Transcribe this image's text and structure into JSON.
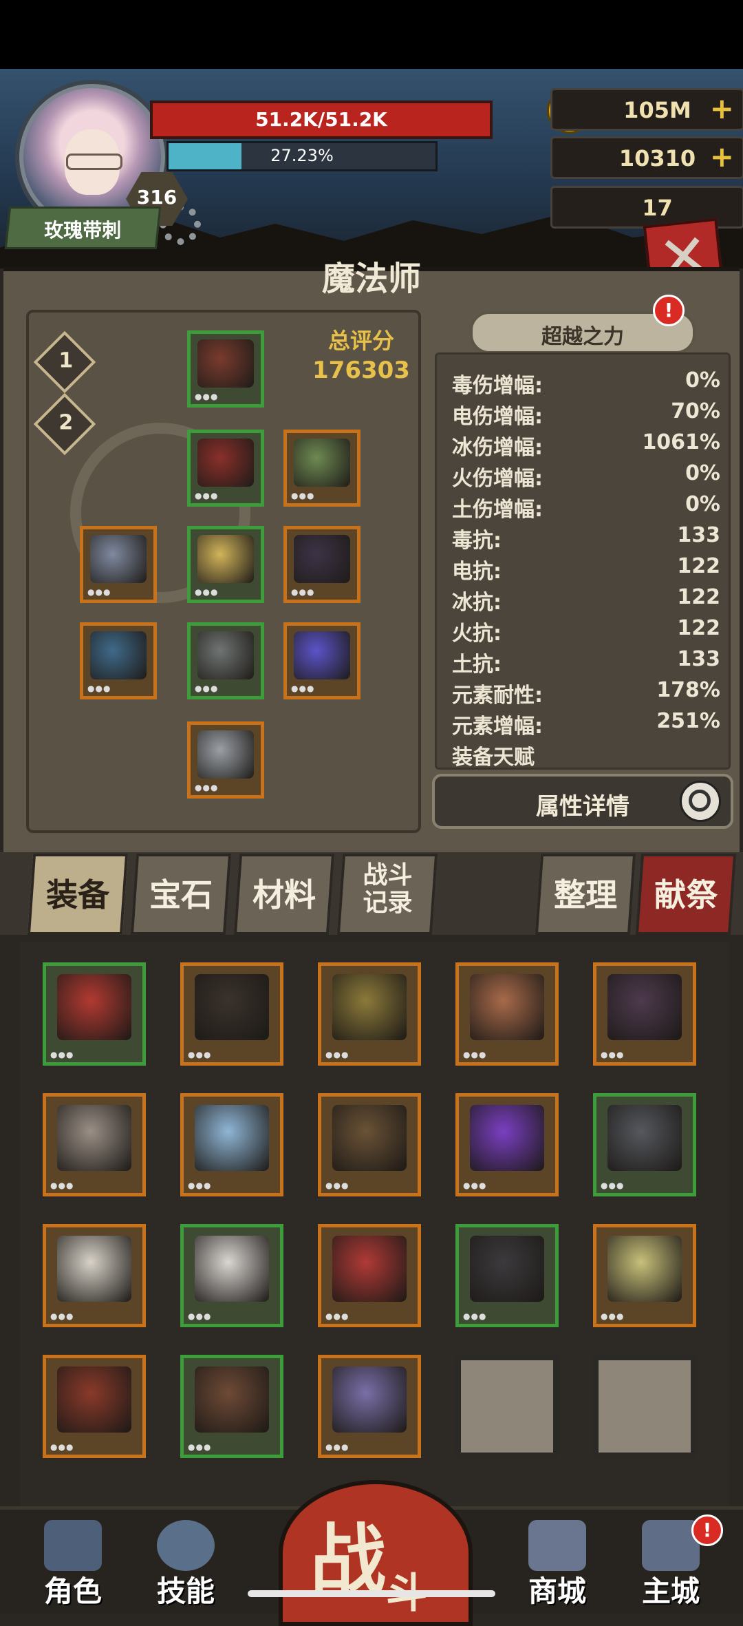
{
  "player": {
    "name": "玫瑰带刺",
    "level": "316",
    "hp_text": "51.2K/51.2K",
    "xp_text": "27.23%",
    "xp_fraction": 0.2723
  },
  "currencies": [
    {
      "icon": "gold-coin-icon",
      "value": "105M",
      "plus": "+"
    },
    {
      "icon": "purple-gem-icon",
      "value": "10310",
      "plus": "+"
    },
    {
      "icon": "ram-skull-icon",
      "value": "17"
    }
  ],
  "close_glyph": "✕",
  "class_title": "魔法师",
  "loadouts": [
    "1",
    "2"
  ],
  "score": {
    "label": "总评分",
    "value": "176303"
  },
  "surpass": {
    "label": "超越之力",
    "alert": "!"
  },
  "stats": [
    {
      "k": "毒伤增幅:",
      "v": "0%"
    },
    {
      "k": "电伤增幅:",
      "v": "70%"
    },
    {
      "k": "冰伤增幅:",
      "v": "1061%"
    },
    {
      "k": "火伤增幅:",
      "v": "0%"
    },
    {
      "k": "土伤增幅:",
      "v": "0%"
    },
    {
      "k": "毒抗:",
      "v": "133"
    },
    {
      "k": "电抗:",
      "v": "122"
    },
    {
      "k": "冰抗:",
      "v": "122"
    },
    {
      "k": "火抗:",
      "v": "122"
    },
    {
      "k": "土抗:",
      "v": "133"
    },
    {
      "k": "元素耐性:",
      "v": "178%"
    },
    {
      "k": "元素增幅:",
      "v": "251%"
    },
    {
      "k": "装备天赋",
      "v": ""
    }
  ],
  "detail_button": "属性详情",
  "tabs": [
    "装备",
    "宝石",
    "材料",
    "战斗记录",
    "整理",
    "献祭"
  ],
  "colors": {
    "hp": "#b9241f",
    "xp": "#4fb3c8",
    "rare": "#c9721c",
    "uncommon": "#3c9d3a",
    "alert": "#d92a24"
  },
  "equipped": [
    {
      "name": "helmet",
      "rarity": "green",
      "color": "#7a3b2e"
    },
    {
      "name": "armor",
      "rarity": "green",
      "color": "#8a2f2a"
    },
    {
      "name": "map",
      "rarity": "orange",
      "color": "#6e8a52"
    },
    {
      "name": "bracelet",
      "rarity": "orange",
      "color": "#7f8aa0"
    },
    {
      "name": "ring",
      "rarity": "green",
      "color": "#d2b45a"
    },
    {
      "name": "mask",
      "rarity": "orange",
      "color": "#3d3346"
    },
    {
      "name": "staff",
      "rarity": "orange",
      "color": "#3f6a8a"
    },
    {
      "name": "gauntlet",
      "rarity": "green",
      "color": "#6f7472"
    },
    {
      "name": "orb",
      "rarity": "orange",
      "color": "#5b54c9"
    },
    {
      "name": "boots",
      "rarity": "orange",
      "color": "#9aa0a6"
    }
  ],
  "inventory": [
    {
      "name": "necklace",
      "rarity": "green",
      "color": "#b23a32"
    },
    {
      "name": "cloak",
      "rarity": "orange",
      "color": "#3a322c"
    },
    {
      "name": "sword",
      "rarity": "orange",
      "color": "#8c7a3a"
    },
    {
      "name": "fire-staff",
      "rarity": "orange",
      "color": "#a86a4a"
    },
    {
      "name": "claw",
      "rarity": "orange",
      "color": "#4e3a4e"
    },
    {
      "name": "bone-crown",
      "rarity": "orange",
      "color": "#9a8f86"
    },
    {
      "name": "rune-stone",
      "rarity": "orange",
      "color": "#8fb6d6"
    },
    {
      "name": "bracer",
      "rarity": "orange",
      "color": "#6a5236"
    },
    {
      "name": "crystal",
      "rarity": "orange",
      "color": "#7a3fc2"
    },
    {
      "name": "vest",
      "rarity": "green",
      "color": "#55585e"
    },
    {
      "name": "pants",
      "rarity": "orange",
      "color": "#d8d2c8"
    },
    {
      "name": "hood",
      "rarity": "green",
      "color": "#d9d6d2"
    },
    {
      "name": "scroll",
      "rarity": "orange",
      "color": "#b03a36"
    },
    {
      "name": "armor",
      "rarity": "green",
      "color": "#3c3a3d"
    },
    {
      "name": "serpent-staff",
      "rarity": "orange",
      "color": "#c8c07a"
    },
    {
      "name": "axe",
      "rarity": "orange",
      "color": "#8a3a2a"
    },
    {
      "name": "belt",
      "rarity": "green",
      "color": "#6e4a36"
    },
    {
      "name": "bone-charm",
      "rarity": "orange",
      "color": "#7a6fa8"
    },
    {
      "name": "empty",
      "rarity": "empty",
      "color": ""
    },
    {
      "name": "empty",
      "rarity": "empty",
      "color": ""
    }
  ],
  "nav": [
    {
      "label": "角色",
      "icon": "character-icon"
    },
    {
      "label": "技能",
      "icon": "skill-icon"
    },
    {
      "label": "战斗",
      "icon": "battle-icon"
    },
    {
      "label": "商城",
      "icon": "shop-icon"
    },
    {
      "label": "主城",
      "icon": "castle-icon",
      "alert": "!"
    }
  ]
}
